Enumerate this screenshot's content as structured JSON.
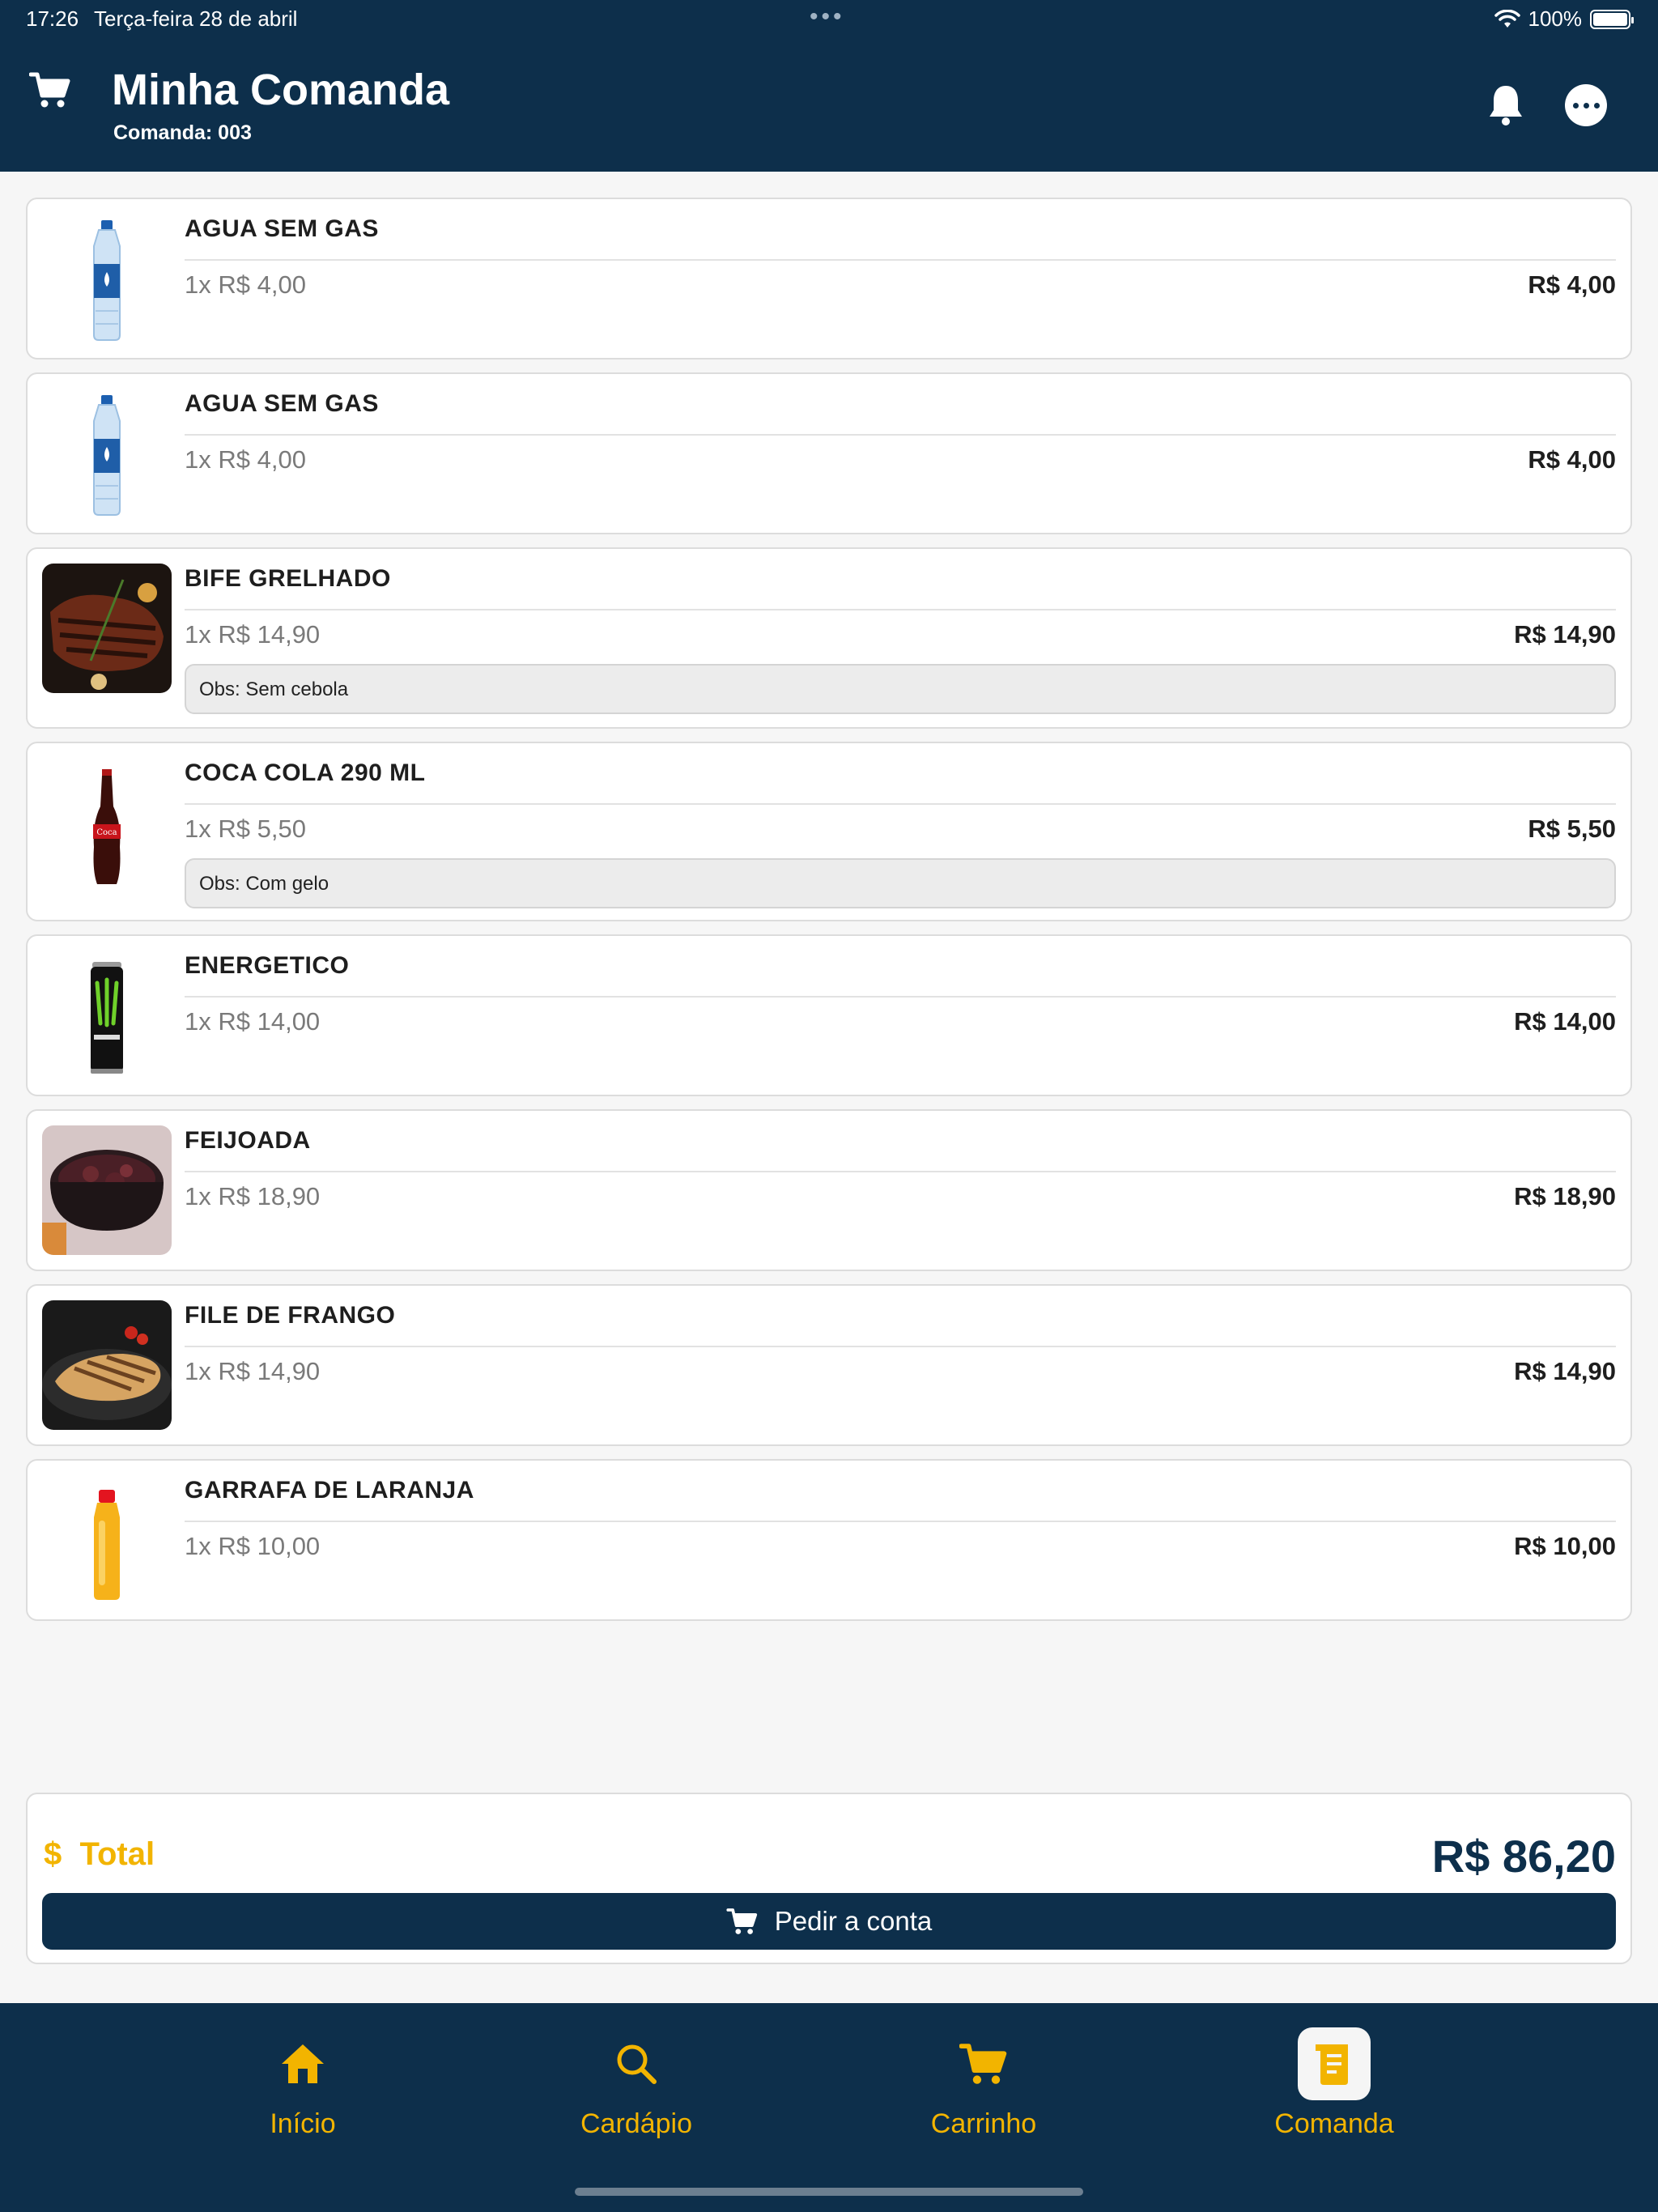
{
  "status_bar": {
    "time": "17:26",
    "date": "Terça-feira 28 de abril",
    "battery": "100%"
  },
  "header": {
    "title": "Minha Comanda",
    "subtitle": "Comanda: 003"
  },
  "items": [
    {
      "name": "AGUA SEM GAS",
      "unit": "1x R$ 4,00",
      "total": "R$ 4,00",
      "obs": "",
      "image": "water-bottle"
    },
    {
      "name": "AGUA SEM GAS",
      "unit": "1x R$ 4,00",
      "total": "R$ 4,00",
      "obs": "",
      "image": "water-bottle"
    },
    {
      "name": "BIFE GRELHADO",
      "unit": "1x R$ 14,90",
      "total": "R$ 14,90",
      "obs": "Obs: Sem cebola",
      "image": "grilled-steak"
    },
    {
      "name": "COCA COLA 290 ML",
      "unit": "1x R$ 5,50",
      "total": "R$ 5,50",
      "obs": "Obs: Com gelo",
      "image": "cola-bottle"
    },
    {
      "name": "ENERGETICO",
      "unit": "1x R$ 14,00",
      "total": "R$ 14,00",
      "obs": "",
      "image": "energy-drink-can"
    },
    {
      "name": "FEIJOADA",
      "unit": "1x R$ 18,90",
      "total": "R$ 18,90",
      "obs": "",
      "image": "feijoada-pot"
    },
    {
      "name": "FILE DE FRANGO",
      "unit": "1x R$ 14,90",
      "total": "R$ 14,90",
      "obs": "",
      "image": "grilled-chicken"
    },
    {
      "name": "GARRAFA DE LARANJA",
      "unit": "1x R$ 10,00",
      "total": "R$ 10,00",
      "obs": "",
      "image": "orange-juice-bottle"
    }
  ],
  "summary": {
    "currency_symbol": "$",
    "total_label": "Total",
    "total_value": "R$ 86,20",
    "order_button": "Pedir a conta"
  },
  "tabs": [
    {
      "label": "Início",
      "icon": "home-icon"
    },
    {
      "label": "Cardápio",
      "icon": "search-icon"
    },
    {
      "label": "Carrinho",
      "icon": "cart-icon"
    },
    {
      "label": "Comanda",
      "icon": "receipt-icon",
      "active": true
    }
  ],
  "colors": {
    "primary": "#0d2f4b",
    "accent": "#f2b400",
    "background": "#f6f6f6"
  }
}
